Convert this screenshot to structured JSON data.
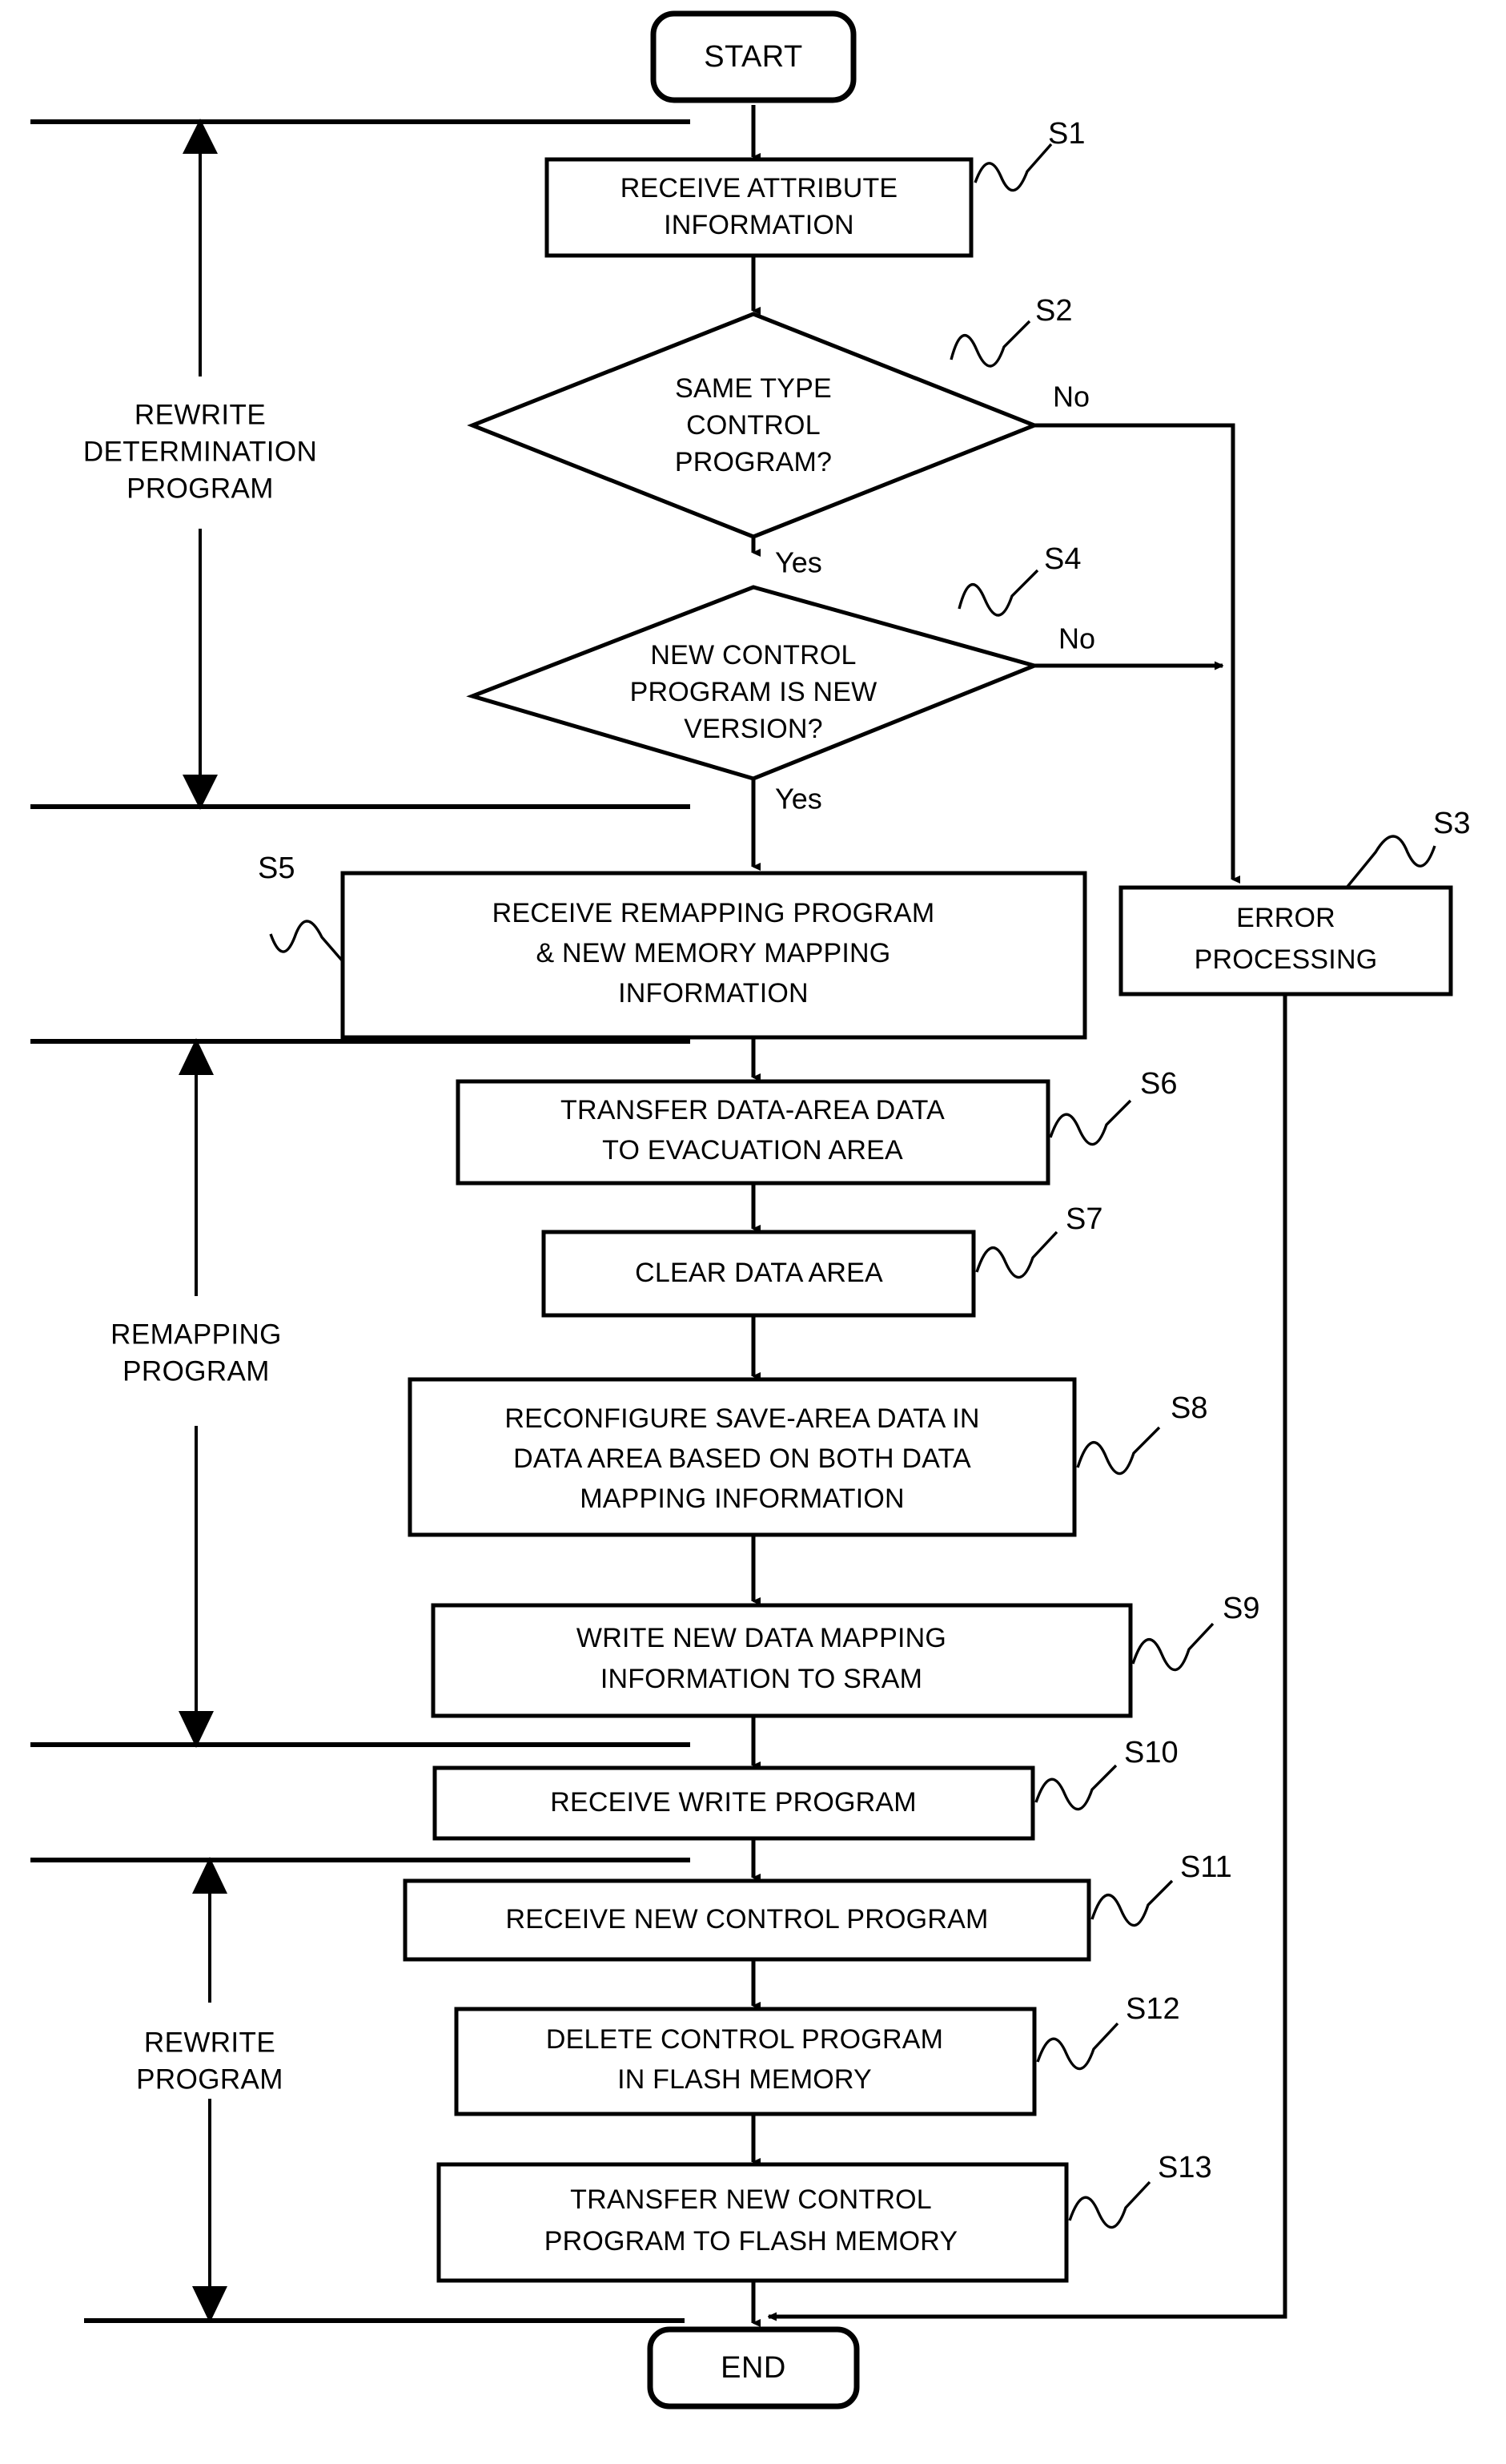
{
  "figure": {
    "kind": "patent-flowchart",
    "terminators": {
      "start": "START",
      "end": "END"
    },
    "nodes": [
      {
        "id": "s1",
        "tag": "S1",
        "shape": "process",
        "lines": [
          "RECEIVE ATTRIBUTE",
          "INFORMATION"
        ]
      },
      {
        "id": "s2",
        "tag": "S2",
        "shape": "decision",
        "lines": [
          "SAME TYPE",
          "CONTROL",
          "PROGRAM?"
        ]
      },
      {
        "id": "s4",
        "tag": "S4",
        "shape": "decision",
        "lines": [
          "NEW CONTROL",
          "PROGRAM IS NEW",
          "VERSION?"
        ]
      },
      {
        "id": "s5",
        "tag": "S5",
        "shape": "process",
        "lines": [
          "RECEIVE REMAPPING PROGRAM",
          "& NEW MEMORY MAPPING",
          "INFORMATION"
        ]
      },
      {
        "id": "s3",
        "tag": "S3",
        "shape": "process",
        "lines": [
          "ERROR",
          "PROCESSING"
        ]
      },
      {
        "id": "s6",
        "tag": "S6",
        "shape": "process",
        "lines": [
          "TRANSFER DATA-AREA DATA",
          "TO EVACUATION AREA"
        ]
      },
      {
        "id": "s7",
        "tag": "S7",
        "shape": "process",
        "lines": [
          "CLEAR DATA AREA"
        ]
      },
      {
        "id": "s8",
        "tag": "S8",
        "shape": "process",
        "lines": [
          "RECONFIGURE SAVE-AREA DATA IN",
          "DATA AREA BASED ON BOTH DATA",
          "MAPPING INFORMATION"
        ]
      },
      {
        "id": "s9",
        "tag": "S9",
        "shape": "process",
        "lines": [
          "WRITE NEW DATA MAPPING",
          "INFORMATION TO SRAM"
        ]
      },
      {
        "id": "s10",
        "tag": "S10",
        "shape": "process",
        "lines": [
          "RECEIVE WRITE PROGRAM"
        ]
      },
      {
        "id": "s11",
        "tag": "S11",
        "shape": "process",
        "lines": [
          "RECEIVE NEW CONTROL PROGRAM"
        ]
      },
      {
        "id": "s12",
        "tag": "S12",
        "shape": "process",
        "lines": [
          "DELETE CONTROL PROGRAM",
          "IN FLASH MEMORY"
        ]
      },
      {
        "id": "s13",
        "tag": "S13",
        "shape": "process",
        "lines": [
          "TRANSFER NEW CONTROL",
          "PROGRAM TO FLASH MEMORY"
        ]
      }
    ],
    "branch_labels": {
      "s2_no": "No",
      "s2_yes": "Yes",
      "s4_no": "No",
      "s4_yes": "Yes"
    },
    "group_brackets": [
      {
        "id": "rewrite-determination",
        "lines": [
          "REWRITE",
          "DETERMINATION",
          "PROGRAM"
        ]
      },
      {
        "id": "remapping",
        "lines": [
          "REMAPPING",
          "PROGRAM"
        ]
      },
      {
        "id": "rewrite",
        "lines": [
          "REWRITE",
          "PROGRAM"
        ]
      }
    ],
    "colors": {
      "ink": "#000000",
      "paper": "#ffffff"
    }
  }
}
